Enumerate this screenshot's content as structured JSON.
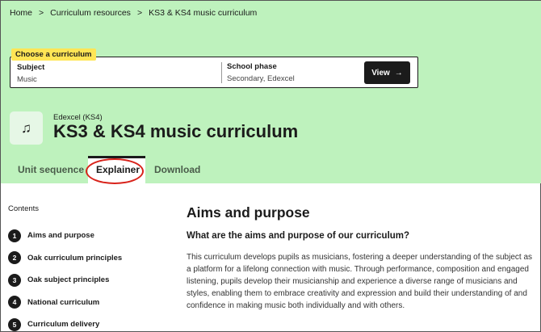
{
  "breadcrumb": {
    "items": [
      "Home",
      "Curriculum resources",
      "KS3 & KS4 music curriculum"
    ],
    "separator": ">"
  },
  "chooser": {
    "tag": "Choose a curriculum",
    "subject_label": "Subject",
    "subject_value": "Music",
    "phase_label": "School phase",
    "phase_value": "Secondary, Edexcel",
    "view_label": "View",
    "view_icon": "→"
  },
  "header": {
    "icon": "music-note-icon",
    "icon_glyph": "♫",
    "eyebrow": "Edexcel (KS4)",
    "title": "KS3 & KS4 music curriculum"
  },
  "tabs": [
    {
      "label": "Unit sequence",
      "active": false
    },
    {
      "label": "Explainer",
      "active": true
    },
    {
      "label": "Download",
      "active": false
    }
  ],
  "contents": {
    "title": "Contents",
    "items": [
      {
        "num": "1",
        "label": "Aims and purpose"
      },
      {
        "num": "2",
        "label": "Oak curriculum principles"
      },
      {
        "num": "3",
        "label": "Oak subject principles"
      },
      {
        "num": "4",
        "label": "National curriculum"
      },
      {
        "num": "5",
        "label": "Curriculum delivery"
      }
    ]
  },
  "main": {
    "heading": "Aims and purpose",
    "subheading": "What are the aims and purpose of our curriculum?",
    "paragraph": "This curriculum develops pupils as musicians, fostering a deeper understanding of the subject as a platform for a lifelong connection with music. Through performance, composition and engaged listening, pupils develop their musicianship and experience a diverse range of musicians and styles, enabling them to embrace creativity and expression and build their understanding of and confidence in making music both individually and with others."
  },
  "colors": {
    "hero_bg": "#bef2bd",
    "tag_bg": "#ffe555",
    "annotation_circle": "#d8221a",
    "primary_button": "#1b1b1b"
  }
}
